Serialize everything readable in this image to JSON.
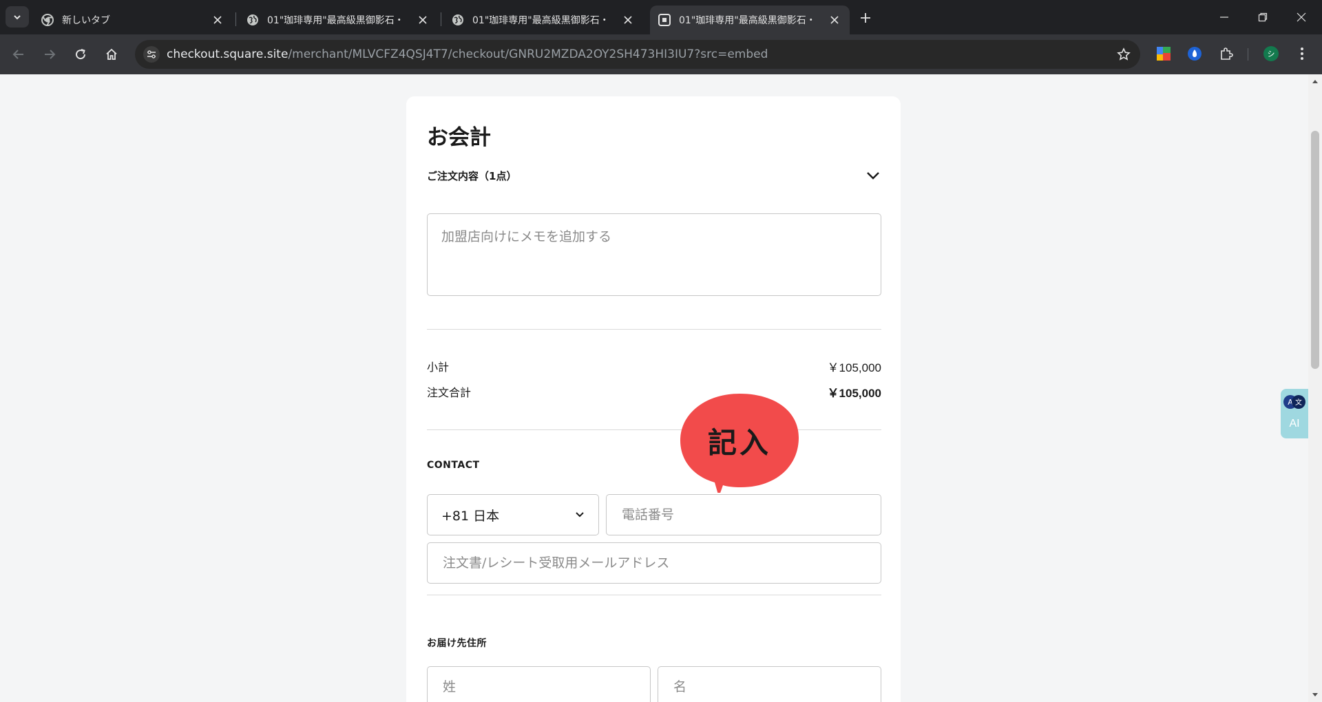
{
  "browser": {
    "tabs": [
      {
        "title": "新しいタブ",
        "favicon": "chrome-icon",
        "active": false
      },
      {
        "title": "01\"珈琲専用\"最高級黒御影石・",
        "favicon": "globe-icon",
        "active": false
      },
      {
        "title": "01\"珈琲専用\"最高級黒御影石・",
        "favicon": "globe-icon",
        "active": false
      },
      {
        "title": "01\"珈琲専用\"最高級黒御影石・",
        "favicon": "square-icon",
        "active": true
      }
    ],
    "url_host": "checkout.square.site",
    "url_path": "/merchant/MLVCFZ4QSJ4T7/checkout/GNRU2MZDA2OY2SH473HI3IU7?src=embed",
    "avatar_letter": "シ"
  },
  "checkout": {
    "title": "お会計",
    "order_summary_label": "ご注文内容（1点）",
    "memo_placeholder": "加盟店向けにメモを追加する",
    "subtotal_label": "小計",
    "subtotal_value": "￥105,000",
    "total_label": "注文合計",
    "total_value": "￥105,000",
    "contact_label": "CONTACT",
    "country_code": "+81 日本",
    "phone_placeholder": "電話番号",
    "email_placeholder": "注文書/レシート受取用メールアドレス",
    "shipping_label": "お届け先住所",
    "last_name_placeholder": "姓",
    "first_name_placeholder": "名"
  },
  "annotation": {
    "bubble_text": "記入",
    "bubble_color": "#f24b4b"
  },
  "ai_widget": {
    "label": "AI",
    "color": "#9fd8e0"
  }
}
